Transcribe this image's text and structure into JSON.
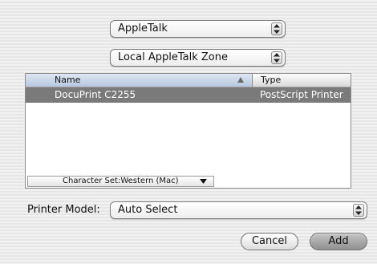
{
  "connection_popup": {
    "value": "AppleTalk"
  },
  "zone_popup": {
    "value": "Local AppleTalk Zone"
  },
  "browser": {
    "columns": {
      "name": "Name",
      "type": "Type"
    },
    "rows": [
      {
        "name": "DocuPrint C2255",
        "type": "PostScript Printer",
        "selected": true
      }
    ],
    "charset": "Character Set:Western (Mac)"
  },
  "printer_model": {
    "label": "Printer Model:",
    "value": "Auto Select"
  },
  "buttons": {
    "cancel": "Cancel",
    "add": "Add"
  },
  "colors": {
    "selection": "#7a7a7a",
    "header_sorted": "#c7d3e5"
  }
}
